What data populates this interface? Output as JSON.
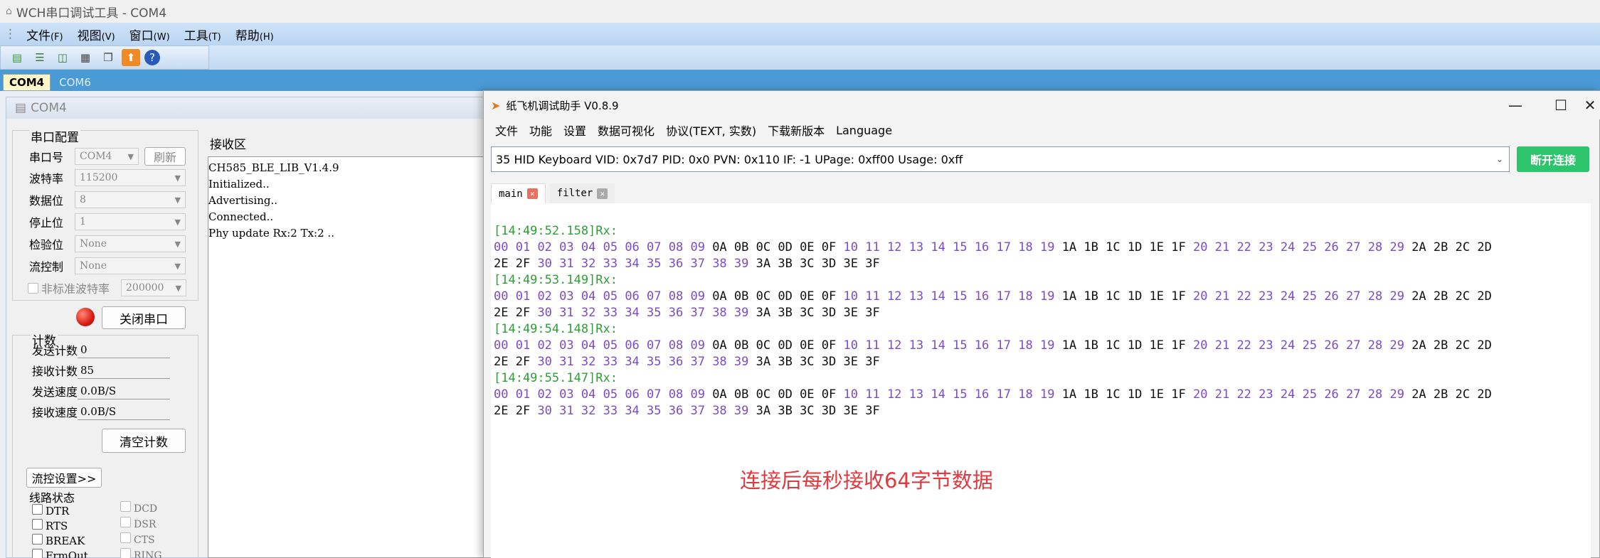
{
  "wch": {
    "title": "WCH串口调试工具 - COM4",
    "menu": [
      {
        "label": "文件",
        "key": "(F)"
      },
      {
        "label": "视图",
        "key": "(V)"
      },
      {
        "label": "窗口",
        "key": "(W)"
      },
      {
        "label": "工具",
        "key": "(T)"
      },
      {
        "label": "帮助",
        "key": "(H)"
      }
    ],
    "tabs": [
      "COM4",
      "COM6"
    ],
    "window_title": "COM4"
  },
  "serial_config": {
    "group_label": "串口配置",
    "port_label": "串口号",
    "port_value": "COM4",
    "refresh_label": "刷新",
    "baud_label": "波特率",
    "baud_value": "115200",
    "databits_label": "数据位",
    "databits_value": "8",
    "stopbits_label": "停止位",
    "stopbits_value": "1",
    "parity_label": "检验位",
    "parity_value": "None",
    "flow_label": "流控制",
    "flow_value": "None",
    "nonstd_label": "非标准波特率",
    "nonstd_value": "200000",
    "close_port_label": "关闭串口"
  },
  "counter": {
    "group_label": "计数",
    "tx_count_label": "发送计数",
    "tx_count": "0",
    "rx_count_label": "接收计数",
    "rx_count": "85",
    "tx_speed_label": "发送速度",
    "tx_speed": "0.0B/S",
    "rx_speed_label": "接收速度",
    "rx_speed": "0.0B/S",
    "clear_label": "清空计数"
  },
  "flow_settings_label": "流控设置>>",
  "line_status": {
    "group_label": "线路状态",
    "left": [
      "DTR",
      "RTS",
      "BREAK",
      "FrmOut"
    ],
    "right": [
      "DCD",
      "DSR",
      "CTS",
      "RING"
    ]
  },
  "receive": {
    "label": "接收区",
    "lines": [
      "CH585_BLE_LIB_V1.4.9",
      "Initialized..",
      "Advertising..",
      "Connected..",
      "Phy update Rx:2 Tx:2 .."
    ]
  },
  "paperplane": {
    "title": "纸飞机调试助手 V0.8.9",
    "menu": [
      "文件",
      "功能",
      "设置",
      "数据可视化",
      "协议(TEXT, 实数)",
      "下载新版本",
      "Language"
    ],
    "device": "35 HID Keyboard VID: 0x7d7 PID: 0x0 PVN: 0x110 IF: -1 UPage: 0xff00 Usage: 0xff",
    "disconnect_label": "断开连接",
    "tabs": [
      "main",
      "filter"
    ],
    "packets": [
      "[14:49:52.158]Rx:",
      "[14:49:53.149]Rx:",
      "[14:49:54.148]Rx:",
      "[14:49:55.147]Rx:"
    ],
    "annotation": "连接后每秒接收64字节数据",
    "colors": {
      "timestamp": "#2e9f36",
      "hex_digit": "#7b4bc8",
      "hex_letter": "#111111",
      "annotation": "#e0393e",
      "disconnect": "#2ec46b"
    }
  }
}
